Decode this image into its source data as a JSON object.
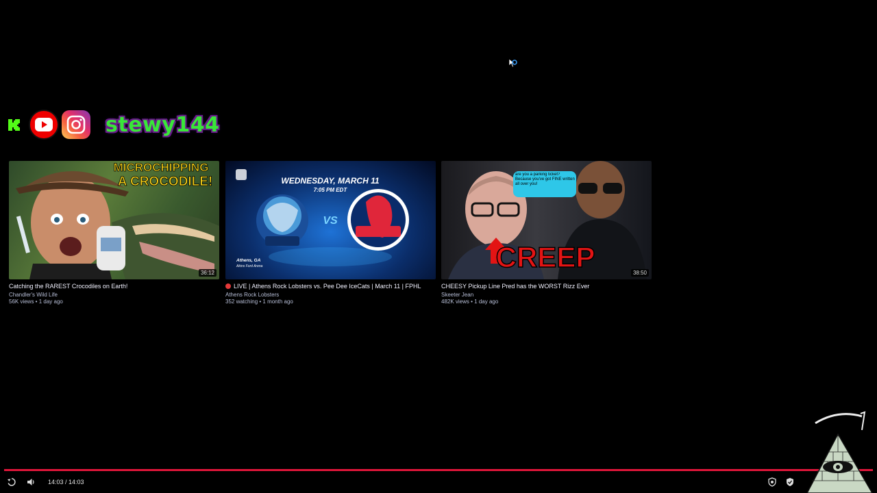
{
  "social": {
    "username": "stewy144",
    "icons": [
      "kick-icon",
      "youtube-icon",
      "instagram-icon"
    ],
    "username_color": "#39e639"
  },
  "videos": [
    {
      "title": "Catching the RAREST Crocodiles on Earth!",
      "channel": "Chandler's Wild Life",
      "meta": "56K views • 1 day ago",
      "duration": "36:12",
      "thumb_text": [
        "MICROCHIPPING",
        "A CROCODILE!"
      ]
    },
    {
      "title": "LIVE | Athens Rock Lobsters vs. Pee Dee IceCats | March 11 | FPHL",
      "channel": "Athens Rock Lobsters",
      "meta": "352 watching • 1 month ago",
      "live": true,
      "thumb_text": [
        "WEDNESDAY, MARCH 11",
        "7:05 PM EDT",
        "VS",
        "Athens, GA",
        "Akins Ford Arena"
      ]
    },
    {
      "title": "CHEESY Pickup Line Pred has the WORST Rizz Ever",
      "channel": "Skeeter Jean",
      "meta": "482K views • 1 day ago",
      "duration": "38:50",
      "thumb_text": [
        "CREEP",
        "are you a parking ticket? Because you've got FINE written all over you!"
      ]
    }
  ],
  "player": {
    "time": "14:03 / 14:03",
    "progress": 1.0,
    "progress_color": "#e0163a"
  }
}
